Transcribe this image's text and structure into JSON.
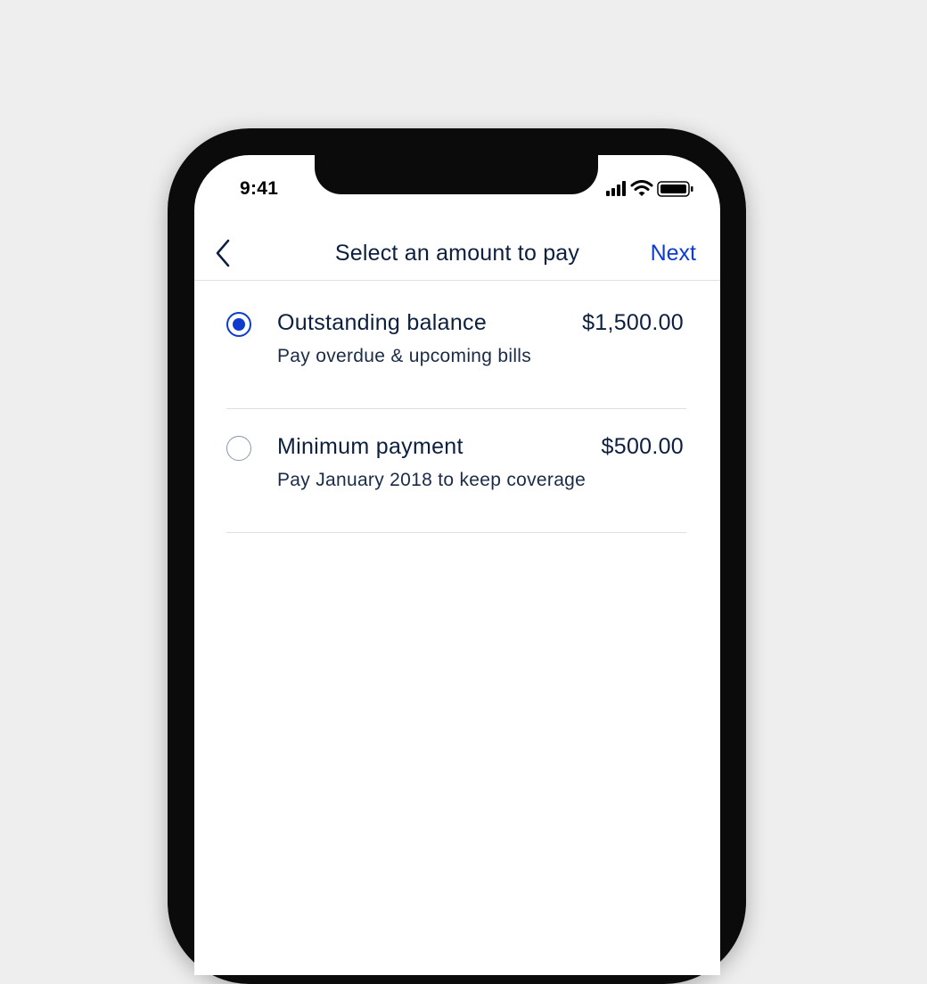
{
  "status_bar": {
    "time": "9:41",
    "icons": [
      "cellular-signal-icon",
      "wifi-icon",
      "battery-icon"
    ]
  },
  "nav": {
    "back_icon": "chevron-left-icon",
    "title": "Select an amount to pay",
    "next_label": "Next"
  },
  "options": [
    {
      "label": "Outstanding balance",
      "amount": "$1,500.00",
      "description": "Pay overdue & upcoming bills",
      "selected": true
    },
    {
      "label": "Minimum payment",
      "amount": "$500.00",
      "description": "Pay January 2018 to keep coverage",
      "selected": false
    }
  ],
  "colors": {
    "accent": "#0d3ccf",
    "text": "#0c1f3f",
    "background": "#eeeeee",
    "divider": "#dde1e6"
  }
}
